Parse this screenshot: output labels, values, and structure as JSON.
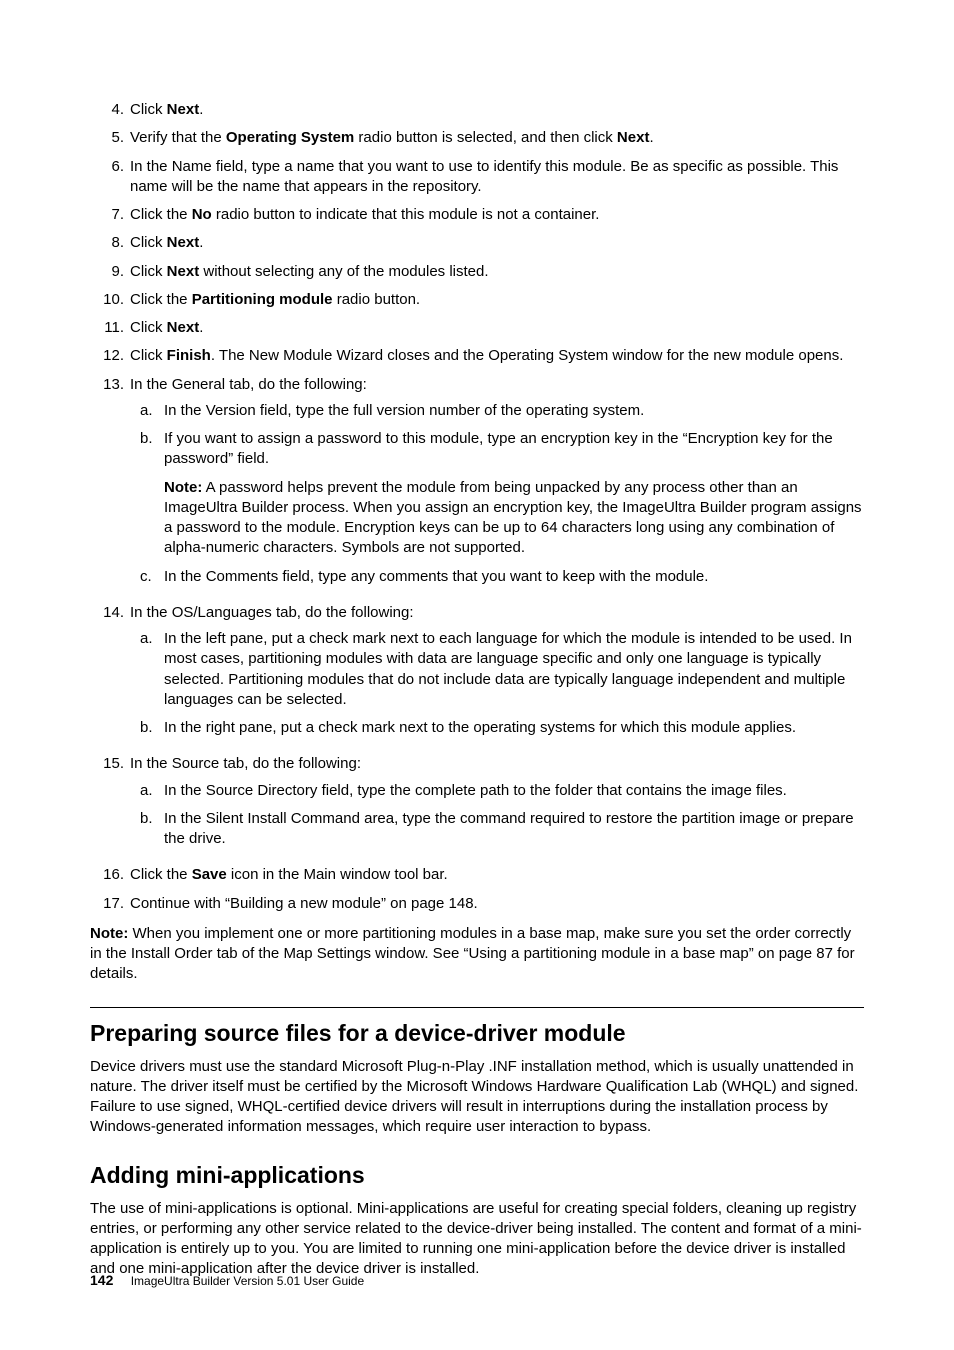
{
  "steps": {
    "s4": {
      "num": "4.",
      "pre": "Click ",
      "b1": "Next",
      "post": "."
    },
    "s5": {
      "num": "5.",
      "pre": "Verify that the ",
      "b1": "Operating System",
      "mid": " radio button is selected, and then click ",
      "b2": "Next",
      "post": "."
    },
    "s6": {
      "num": "6.",
      "text": "In the Name field, type a name that you want to use to identify this module. Be as specific as possible. This name will be the name that appears in the repository."
    },
    "s7": {
      "num": "7.",
      "pre": "Click the ",
      "b1": "No",
      "post": " radio button to indicate that this module is not a container."
    },
    "s8": {
      "num": "8.",
      "pre": "Click ",
      "b1": "Next",
      "post": "."
    },
    "s9": {
      "num": "9.",
      "pre": "Click ",
      "b1": "Next",
      "post": " without selecting any of the modules listed."
    },
    "s10": {
      "num": "10.",
      "pre": "Click the ",
      "b1": "Partitioning module",
      "post": " radio button."
    },
    "s11": {
      "num": "11.",
      "pre": "Click ",
      "b1": "Next",
      "post": "."
    },
    "s12": {
      "num": "12.",
      "pre": "Click ",
      "b1": "Finish",
      "post": ". The New Module Wizard closes and the Operating System window for the new module opens."
    },
    "s13": {
      "num": "13.",
      "intro": "In the General tab, do the following:",
      "a": {
        "let": "a.",
        "text": "In the Version field, type the full version number of the operating system."
      },
      "b": {
        "let": "b.",
        "text": "If you want to assign a password to this module, type an encryption key in the “Encryption key for the password” field.",
        "noteLabel": "Note:",
        "noteText": " A password helps prevent the module from being unpacked by any process other than an ImageUltra Builder process. When you assign an encryption key, the ImageUltra Builder program assigns a password to the module. Encryption keys can be up to 64 characters long using any combination of alpha-numeric characters. Symbols are not supported."
      },
      "c": {
        "let": "c.",
        "text": "In the Comments field, type any comments that you want to keep with the module."
      }
    },
    "s14": {
      "num": "14.",
      "intro": "In the OS/Languages tab, do the following:",
      "a": {
        "let": "a.",
        "text": "In the left pane, put a check mark next to each language for which the module is intended to be used. In most cases, partitioning modules with data are language specific and only one language is typically selected. Partitioning modules that do not include data are typically language independent and multiple languages can be selected."
      },
      "b": {
        "let": "b.",
        "text": "In the right pane, put a check mark next to the operating systems for which this module applies."
      }
    },
    "s15": {
      "num": "15.",
      "intro": "In the Source tab, do the following:",
      "a": {
        "let": "a.",
        "text": "In the Source Directory field, type the complete path to the folder that contains the image files."
      },
      "b": {
        "let": "b.",
        "text": "In the Silent Install Command area, type the command required to restore the partition image or prepare the drive."
      }
    },
    "s16": {
      "num": "16.",
      "pre": "Click the ",
      "b1": "Save",
      "post": " icon in the Main window tool bar."
    },
    "s17": {
      "num": "17.",
      "text": "Continue with “Building a new module” on page 148."
    }
  },
  "bottomNoteLabel": "Note:",
  "bottomNoteText": " When you implement one or more partitioning modules in a base map, make sure you set the order correctly in the Install Order tab of the Map Settings window. See “Using a partitioning module in a base map” on page 87 for details.",
  "sec1": {
    "title": "Preparing source files for a device-driver module",
    "para": "Device drivers must use the standard Microsoft Plug-n-Play .INF installation method, which is usually unattended in nature. The driver itself must be certified by the Microsoft Windows Hardware Qualification Lab (WHQL) and signed. Failure to use signed, WHQL-certified device drivers will result in interruptions during the installation process by Windows-generated information messages, which require user interaction to bypass."
  },
  "sec2": {
    "title": "Adding mini-applications",
    "para": "The use of mini-applications is optional. Mini-applications are useful for creating special folders, cleaning up registry entries, or performing any other service related to the device-driver being installed. The content and format of a mini-application is entirely up to you. You are limited to running one mini-application before the device driver is installed and one mini-application after the device driver is installed."
  },
  "footer": {
    "pageNum": "142",
    "bookTitle": "ImageUltra Builder Version 5.01 User Guide"
  }
}
